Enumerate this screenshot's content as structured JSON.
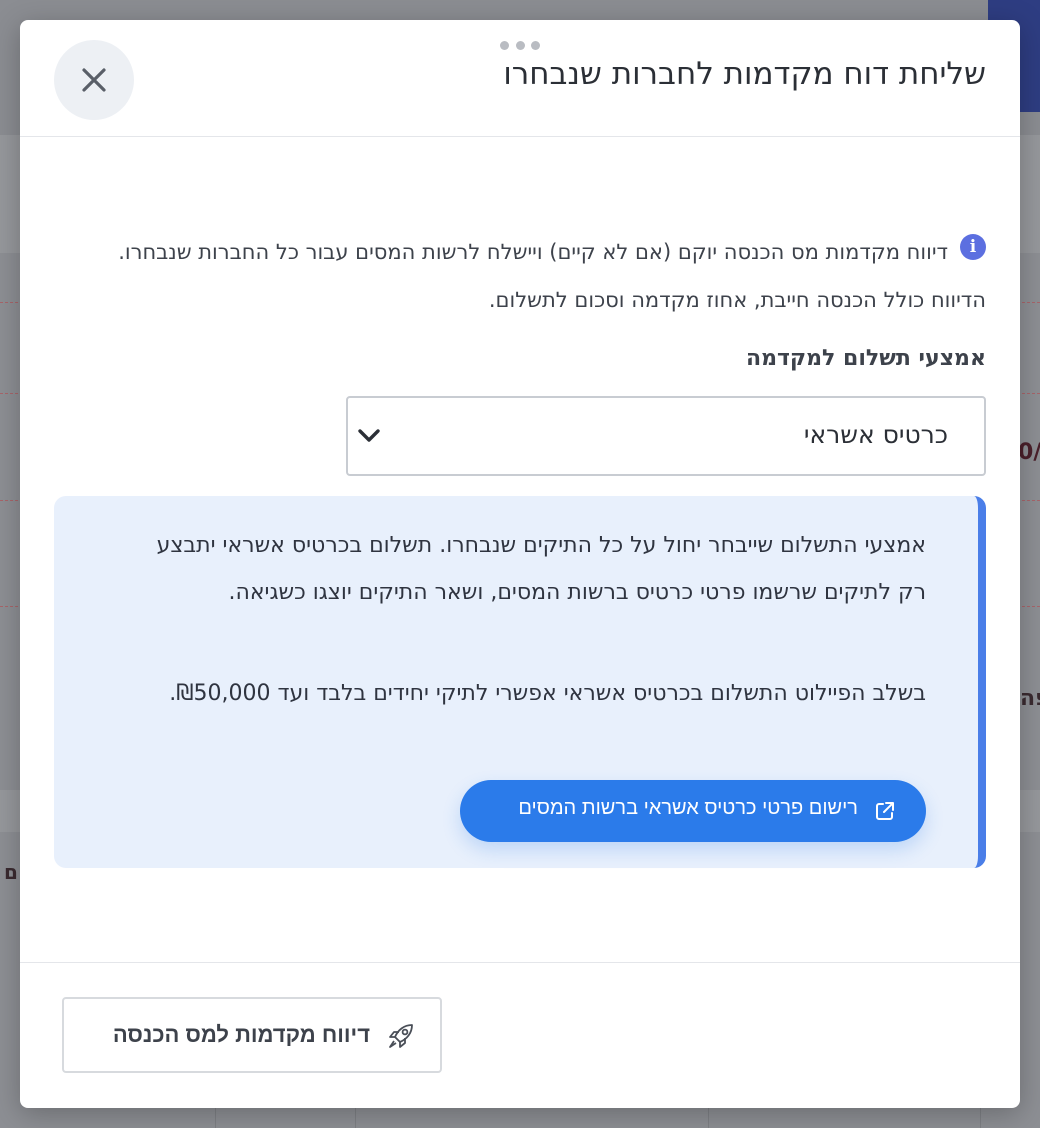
{
  "background": {
    "edge_chars": [
      "/0",
      "פה",
      "ם"
    ]
  },
  "modal": {
    "title": "שליחת דוח מקדמות לחברות שנבחרו",
    "close_icon": "close-icon",
    "info_icon": "info-icon",
    "info_text": "דיווח מקדמות מס הכנסה יוקם (אם לא קיים) ויישלח לרשות המסים עבור כל החברות שנבחרו. הדיווח כולל הכנסה חייבת, אחוז מקדמה וסכום לתשלום.",
    "payment_label": "אמצעי תשלום למקדמה",
    "payment_select": {
      "value": "כרטיס אשראי",
      "chevron_icon": "chevron-down-icon"
    },
    "notice": {
      "paragraph_1": "אמצעי התשלום שייבחר יחול על כל התיקים שנבחרו. תשלום בכרטיס אשראי יתבצע רק לתיקים שרשמו פרטי כרטיס ברשות המסים, ושאר התיקים יוצגו כשגיאה.",
      "paragraph_2": "בשלב הפיילוט התשלום בכרטיס אשראי אפשרי לתיקי יחידים בלבד ועד ₪50,000.",
      "register_button": "רישום פרטי כרטיס אשראי ברשות המסים",
      "register_icon": "external-link-icon"
    },
    "footer": {
      "submit_button": "דיווח מקדמות למס הכנסה",
      "submit_icon": "rocket-icon"
    }
  },
  "colors": {
    "accent": "#2b7bea",
    "notice_bg": "#e8f0fc",
    "notice_border": "#4a7ee8",
    "info_icon": "#5c6fe0",
    "overlay": "#8d8f94"
  }
}
